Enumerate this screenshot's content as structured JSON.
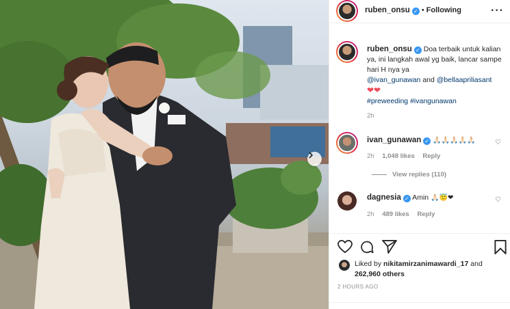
{
  "post": {
    "author": "ruben_onsu",
    "follow_label": "Following",
    "caption_text": "Doa terbaik untuk kalian ya, ini langkah awal yg baik, lancar sampe hari H nya ya",
    "mention1": "@ivan_gunawan",
    "and_word": "and",
    "mention2": "@bellaapriliasant",
    "hashtag1": "#preweeding",
    "hashtag2": "#ivangunawan",
    "caption_time": "2h"
  },
  "comments": [
    {
      "user": "ivan_gunawan",
      "text": "",
      "emojis": "🙏🏻🙏🏻🙏🏻🙏🏻🙏🏻",
      "time": "2h",
      "likes": "1,048 likes",
      "reply_label": "Reply",
      "view_replies": "View replies (110)"
    },
    {
      "user": "dagnesia",
      "text": "Amin",
      "emojis": "🙏🏻😇❤",
      "time": "2h",
      "likes": "489 likes",
      "reply_label": "Reply"
    }
  ],
  "footer": {
    "liked_by": "Liked by",
    "liker": "nikitamirzanimawardi_17",
    "and_word": "and",
    "others": "262,960 others",
    "time_ago": "2 HOURS AGO"
  },
  "colors": {
    "verified": "#3897f0",
    "link": "#00376b",
    "heart": "#ed4956",
    "muted": "#8e8e8e"
  },
  "icons": {
    "like": "heart-icon",
    "comment": "comment-icon",
    "share": "paper-plane-icon",
    "save": "bookmark-icon",
    "carousel_next": "chevron-right-icon"
  }
}
